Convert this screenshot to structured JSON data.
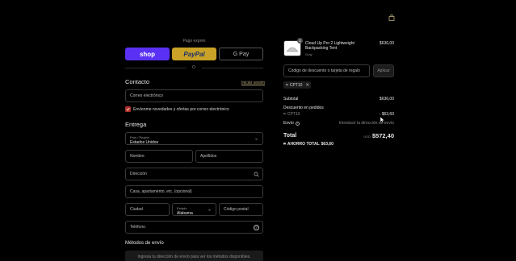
{
  "header": {
    "cart_icon": "bag-icon"
  },
  "express": {
    "title": "Pago exprés",
    "shop_label": "shop",
    "paypal_label": "PayPal",
    "gpay_label": "G Pay",
    "or_label": "O",
    "colors": {
      "shop": "#5a31f4",
      "paypal": "#c9a227",
      "gpay": "#000000"
    }
  },
  "contact": {
    "title": "Contacto",
    "login_link": "Iniciar sesión",
    "email_placeholder": "Correo electrónico",
    "newsletter_label": "Envíenme novedades y ofertas por correo electrónico",
    "newsletter_checked": true
  },
  "delivery": {
    "title": "Entrega",
    "country_label": "País / Región",
    "country_value": "Estados Unidos",
    "first_name": "Nombre",
    "last_name": "Apellidos",
    "address": "Dirección",
    "apartment": "Casa, apartamento, etc. (opcional)",
    "city": "Ciudad",
    "state_label": "Estado",
    "state_value": "Alabama",
    "zip": "Código postal",
    "phone": "Teléfono"
  },
  "shipping": {
    "title": "Métodos de envío",
    "notice": "Ingresa tu dirección de envío para ver los métodos disponibles."
  },
  "summary": {
    "product": {
      "name": "Cloud Up Pro 2 Lightweight Backpacking Tent",
      "variant": "Gray",
      "price": "$636,00",
      "quantity": "1"
    },
    "discount_placeholder": "Código de descuento o tarjeta de regalo",
    "apply_label": "Aplicar",
    "applied_code": "CPT10",
    "subtotal_label": "Subtotal",
    "subtotal_value": "$636,00",
    "order_discount_label": "Descuento en pedidos",
    "order_discount_code": "CPT10",
    "order_discount_value": "- $63,60",
    "shipping_label": "Envío",
    "shipping_value": "Introducir la dirección de envío",
    "total_label": "Total",
    "total_currency": "USD",
    "total_value": "$572,40",
    "savings_label": "AHORRO TOTAL",
    "savings_value": "$63,60"
  }
}
